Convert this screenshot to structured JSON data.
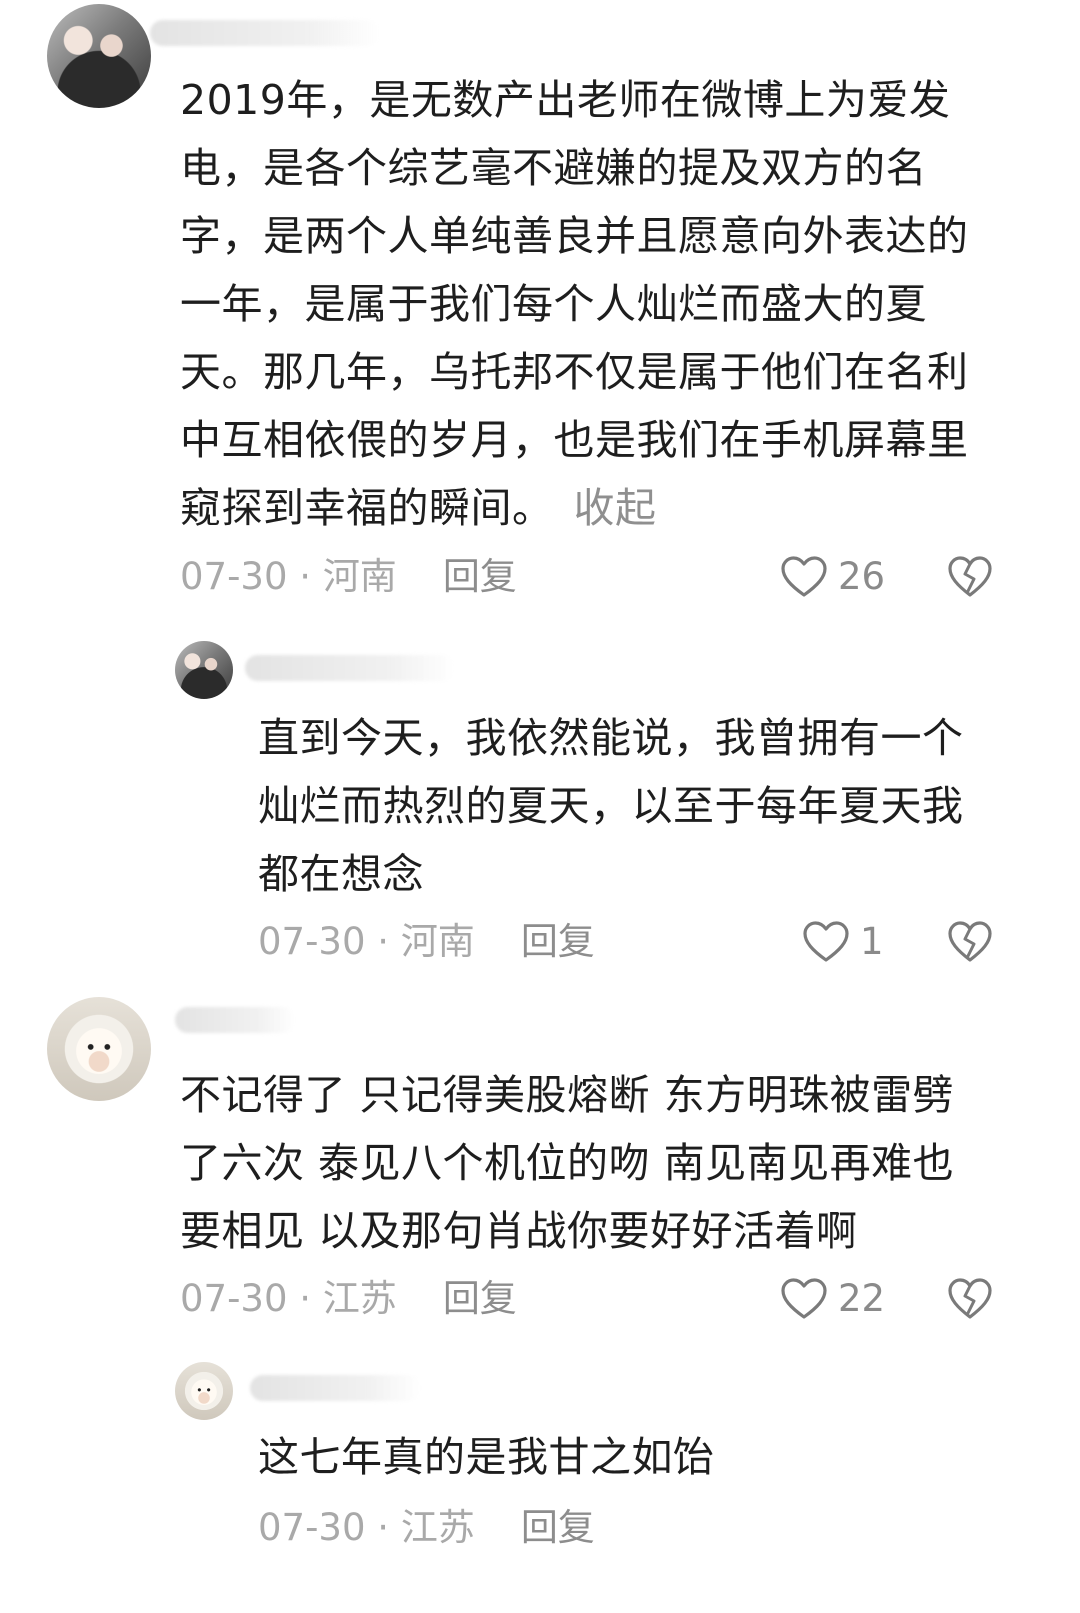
{
  "comments": [
    {
      "text_lines": [
        "2019年，是无数产出老师在微博上为爱发",
        "电，是各个综艺毫不避嫌的提及双方的名",
        "字，是两个人单纯善良并且愿意向外表达的",
        "一年，是属于我们每个人灿烂而盛大的夏",
        "天。那几年，乌托邦不仅是属于他们在名利",
        "中互相依偎的岁月，也是我们在手机屏幕里",
        "窥探到幸福的瞬间。"
      ],
      "collapse_label": "收起",
      "date": "07-30",
      "location": "河南",
      "reply_label": "回复",
      "like_count": "26"
    },
    {
      "text_lines": [
        "直到今天，我依然能说，我曾拥有一个",
        "灿烂而热烈的夏天，以至于每年夏天我",
        "都在想念"
      ],
      "date": "07-30",
      "location": "河南",
      "reply_label": "回复",
      "like_count": "1"
    },
    {
      "text_lines": [
        "不记得了 只记得美股熔断 东方明珠被雷劈",
        "了六次  泰见八个机位的吻 南见南见再难也",
        "要相见 以及那句肖战你要好好活着啊"
      ],
      "date": "07-30",
      "location": "江苏",
      "reply_label": "回复",
      "like_count": "22"
    },
    {
      "text_lines": [
        "这七年真的是我甘之如饴"
      ],
      "date": "07-30",
      "location": "江苏",
      "reply_label": "回复"
    }
  ],
  "separator": " · ",
  "icons": {
    "like": "heart-outline-icon",
    "dislike": "broken-heart-icon"
  },
  "colors": {
    "text": "#1e1e1e",
    "meta": "#a9a9a9",
    "icon": "#7a7a7a"
  }
}
